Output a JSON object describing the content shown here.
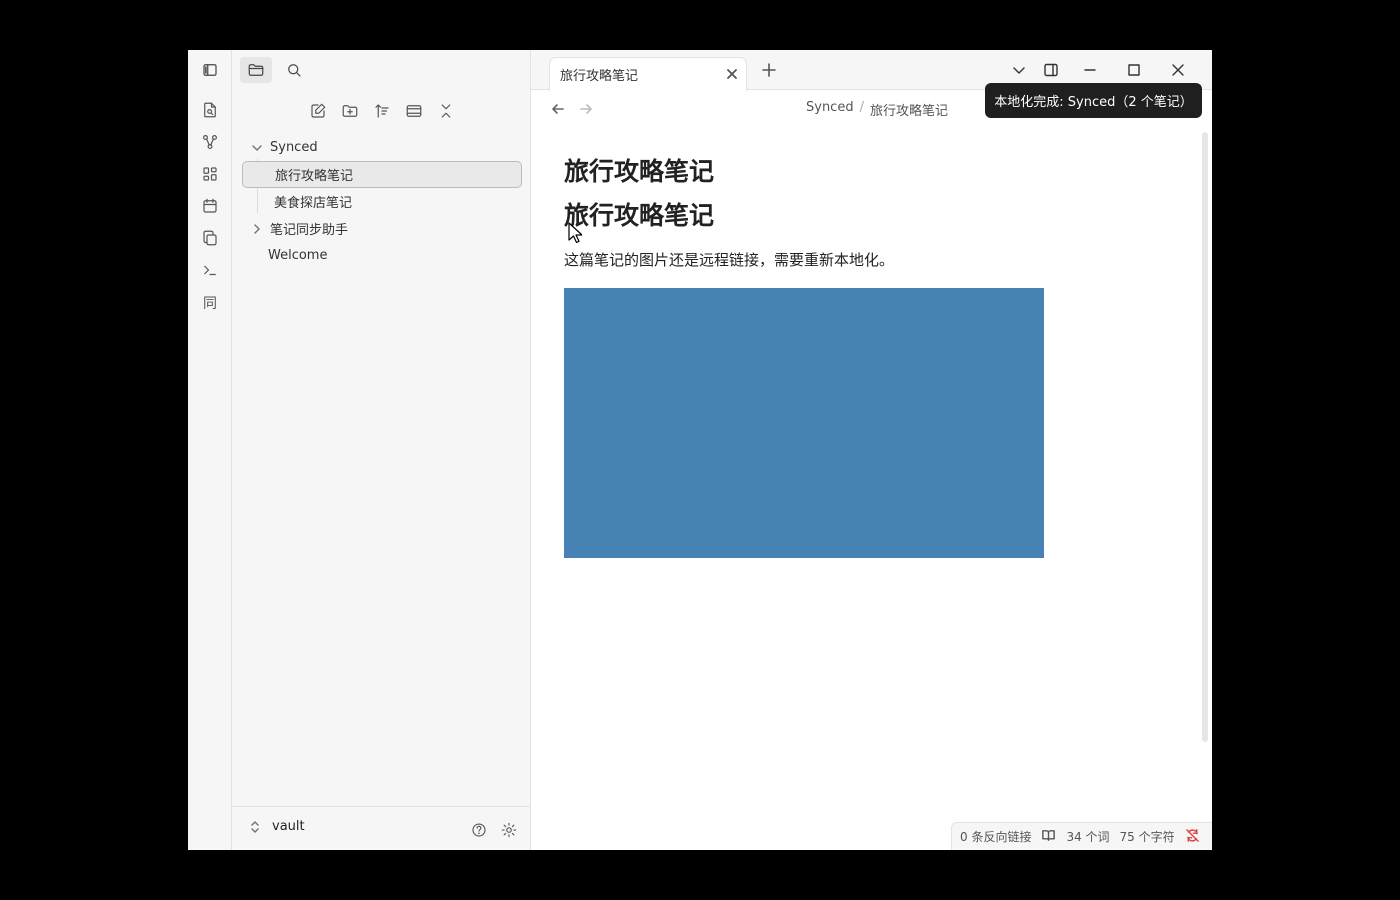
{
  "ribbon": {
    "items": [
      {
        "icon": "file-search-icon"
      },
      {
        "icon": "graph-icon"
      },
      {
        "icon": "canvas-grid-icon"
      },
      {
        "icon": "calendar-icon"
      },
      {
        "icon": "copy-icon"
      },
      {
        "icon": "terminal-icon"
      },
      {
        "icon": "sync-plugin-icon",
        "label": "同"
      }
    ]
  },
  "sidebar": {
    "tree": [
      {
        "label": "Synced",
        "type": "folder",
        "expanded": true
      },
      {
        "label": "旅行攻略笔记",
        "type": "file",
        "selected": true
      },
      {
        "label": "美食探店笔记",
        "type": "file"
      },
      {
        "label": "笔记同步助手",
        "type": "folder",
        "expanded": false
      },
      {
        "label": "Welcome",
        "type": "file"
      }
    ],
    "vault_name": "vault"
  },
  "tabs": [
    {
      "label": "旅行攻略笔记",
      "active": true
    }
  ],
  "breadcrumb": {
    "folder": "Synced",
    "separator": "/",
    "file": "旅行攻略笔记"
  },
  "note": {
    "heading1": "旅行攻略笔记",
    "heading2": "旅行攻略笔记",
    "paragraph": "这篇笔记的图片还是远程链接，需要重新本地化。",
    "image_color": "#4682b4"
  },
  "status": {
    "backlinks": "0 条反向链接",
    "words": "34 个词",
    "chars": "75 个字符"
  },
  "tooltip": {
    "text": "本地化完成: Synced（2 个笔记）"
  },
  "colors": {
    "accent": "#4682b4",
    "sync_error": "#e03e3e"
  }
}
